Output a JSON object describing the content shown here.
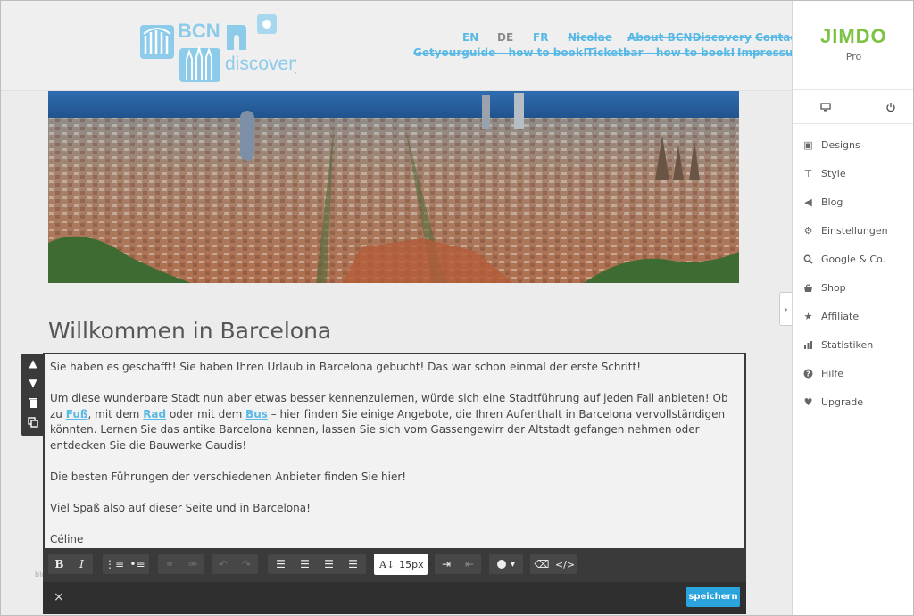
{
  "header": {
    "logo_text_top": "BCN",
    "logo_text_bottom": "discovery",
    "nav_languages": [
      "EN",
      "DE",
      "FR"
    ],
    "nav_row1": [
      "Nicolae",
      "About BCNDiscovery",
      "Contact"
    ],
    "nav_row2": [
      "Getyourguide – how to book!",
      "Ticketbar – how to book!",
      "Impressum"
    ]
  },
  "main": {
    "title": "Willkommen in Barcelona",
    "paragraphs": {
      "p1": "Sie haben es geschafft! Sie haben Ihren Urlaub in Barcelona gebucht! Das war schon einmal der erste Schritt!",
      "p2_a": "Um diese wunderbare Stadt nun aber etwas besser kennenzulernen, würde sich eine Stadtführung auf jeden Fall anbieten! Ob zu ",
      "p2_link1": "Fuß",
      "p2_b": ", mit dem ",
      "p2_link2": "Rad",
      "p2_c": " oder mit dem ",
      "p2_link3": "Bus",
      "p2_d": " – hier finden Sie einige Angebote, die Ihren Aufenthalt in Barcelona vervollständigen könnten. Lernen Sie das antike Barcelona kennen, lassen Sie sich vom Gassengewirr der Altstadt gefangen nehmen oder entdecken Sie die Bauwerke Gaudis!",
      "p3": "Die besten Führungen der verschiedenen Anbieter finden Sie hier!",
      "p4": "Viel Spaß also auf dieser Seite und in Barcelona!",
      "p5": "Céline"
    },
    "ghost_label": "blog"
  },
  "editor": {
    "font_size": "15px",
    "font_size_icon": "A↕",
    "save_label": "speichern",
    "close_label": "×",
    "side_tools": [
      "move-up",
      "move-down",
      "delete",
      "duplicate"
    ]
  },
  "panel": {
    "brand": "JIMDO",
    "plan": "Pro",
    "menu": [
      {
        "label": "Designs",
        "icon": "designs-icon"
      },
      {
        "label": "Style",
        "icon": "style-icon"
      },
      {
        "label": "Blog",
        "icon": "blog-icon"
      },
      {
        "label": "Einstellungen",
        "icon": "settings-icon"
      },
      {
        "label": "Google & Co.",
        "icon": "search-icon"
      },
      {
        "label": "Shop",
        "icon": "shop-icon"
      },
      {
        "label": "Affiliate",
        "icon": "star-icon"
      },
      {
        "label": "Statistiken",
        "icon": "stats-icon"
      },
      {
        "label": "Hilfe",
        "icon": "help-icon"
      },
      {
        "label": "Upgrade",
        "icon": "heart-icon"
      }
    ]
  },
  "colors": {
    "accent": "#59b9e6",
    "save": "#2ba3dd",
    "toolbar": "#3a3a3a"
  }
}
